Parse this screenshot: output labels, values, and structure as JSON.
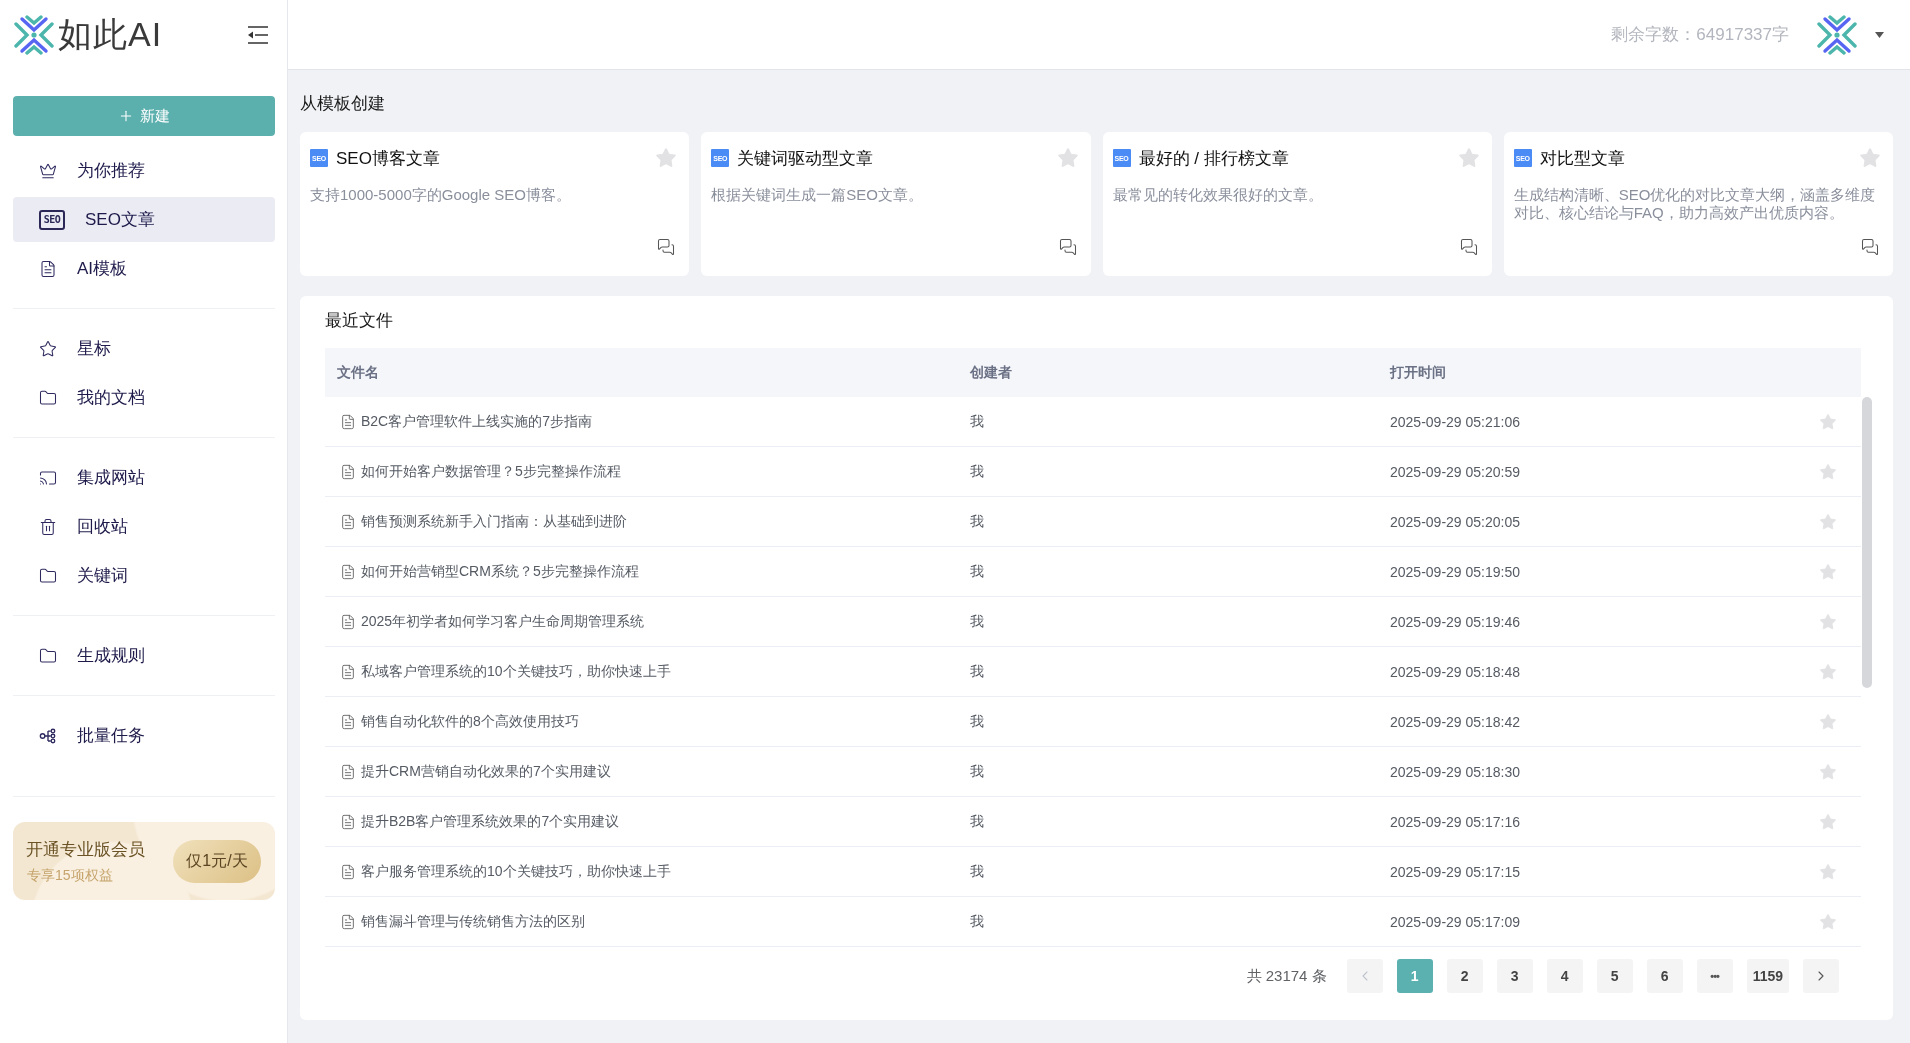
{
  "sidebar": {
    "logo": "如此AI",
    "new_button": "新建",
    "groups": [
      {
        "items": [
          {
            "label": "为你推荐",
            "selected": false
          },
          {
            "label": "SEO文章",
            "badge": "SEO",
            "selected": true
          },
          {
            "label": "AI模板",
            "selected": false
          }
        ]
      },
      {
        "items": [
          {
            "label": "星标",
            "selected": false
          },
          {
            "label": "我的文档",
            "selected": false
          }
        ]
      },
      {
        "items": [
          {
            "label": "集成网站",
            "selected": false
          },
          {
            "label": "回收站",
            "selected": false
          },
          {
            "label": "关键词",
            "selected": false
          }
        ]
      },
      {
        "items": [
          {
            "label": "生成规则",
            "selected": false
          }
        ]
      },
      {
        "items": [
          {
            "label": "批量任务",
            "selected": false
          }
        ]
      }
    ],
    "promo": {
      "title": "开通专业版会员",
      "subtitle": "专享15项权益",
      "badge": "仅1元/天"
    }
  },
  "header": {
    "quota": "剩余字数：64917337字"
  },
  "templates": {
    "title": "从模板创建",
    "cards": [
      {
        "badge": "SEO",
        "title": "SEO博客文章",
        "description": "支持1000-5000字的Google SEO博客。",
        "starred": false
      },
      {
        "badge": "SEO",
        "title": "关键词驱动型文章",
        "description": "根据关键词生成一篇SEO文章。",
        "starred": false
      },
      {
        "badge": "SEO",
        "title": "最好的 / 排行榜文章",
        "description": "最常见的转化效果很好的文章。",
        "starred": false
      },
      {
        "badge": "SEO",
        "title": "对比型文章",
        "description": "生成结构清晰、SEO优化的对比文章大纲，涵盖多维度对比、核心结论与FAQ，助力高效产出优质内容。",
        "starred": false
      }
    ]
  },
  "recent_files": {
    "title": "最近文件",
    "columns": [
      "文件名",
      "创建者",
      "打开时间"
    ],
    "rows": [
      {
        "name": "B2C客户管理软件上线实施的7步指南",
        "creator": "我",
        "opened": "2025-09-29 05:21:06",
        "starred": false
      },
      {
        "name": "如何开始客户数据管理？5步完整操作流程",
        "creator": "我",
        "opened": "2025-09-29 05:20:59",
        "starred": false
      },
      {
        "name": "销售预测系统新手入门指南：从基础到进阶",
        "creator": "我",
        "opened": "2025-09-29 05:20:05",
        "starred": false
      },
      {
        "name": "如何开始营销型CRM系统？5步完整操作流程",
        "creator": "我",
        "opened": "2025-09-29 05:19:50",
        "starred": false
      },
      {
        "name": "2025年初学者如何学习客户生命周期管理系统",
        "creator": "我",
        "opened": "2025-09-29 05:19:46",
        "starred": false
      },
      {
        "name": "私域客户管理系统的10个关键技巧，助你快速上手",
        "creator": "我",
        "opened": "2025-09-29 05:18:48",
        "starred": false
      },
      {
        "name": "销售自动化软件的8个高效使用技巧",
        "creator": "我",
        "opened": "2025-09-29 05:18:42",
        "starred": false
      },
      {
        "name": "提升CRM营销自动化效果的7个实用建议",
        "creator": "我",
        "opened": "2025-09-29 05:18:30",
        "starred": false
      },
      {
        "name": "提升B2B客户管理系统效果的7个实用建议",
        "creator": "我",
        "opened": "2025-09-29 05:17:16",
        "starred": false
      },
      {
        "name": "客户服务管理系统的10个关键技巧，助你快速上手",
        "creator": "我",
        "opened": "2025-09-29 05:17:15",
        "starred": false
      },
      {
        "name": "销售漏斗管理与传统销售方法的区别",
        "creator": "我",
        "opened": "2025-09-29 05:17:09",
        "starred": false
      }
    ],
    "pagination": {
      "total": "共 23174 条",
      "prev": {
        "disabled": true
      },
      "next": {
        "disabled": false
      },
      "pages": [
        {
          "kind": "page",
          "label": "1",
          "selected": true
        },
        {
          "kind": "page",
          "label": "2",
          "selected": false
        },
        {
          "kind": "page",
          "label": "3",
          "selected": false
        },
        {
          "kind": "page",
          "label": "4",
          "selected": false
        },
        {
          "kind": "page",
          "label": "5",
          "selected": false
        },
        {
          "kind": "page",
          "label": "6",
          "selected": false
        },
        {
          "kind": "more",
          "label": "•••",
          "selected": false
        },
        {
          "kind": "page",
          "label": "1159",
          "selected": false
        }
      ]
    }
  }
}
